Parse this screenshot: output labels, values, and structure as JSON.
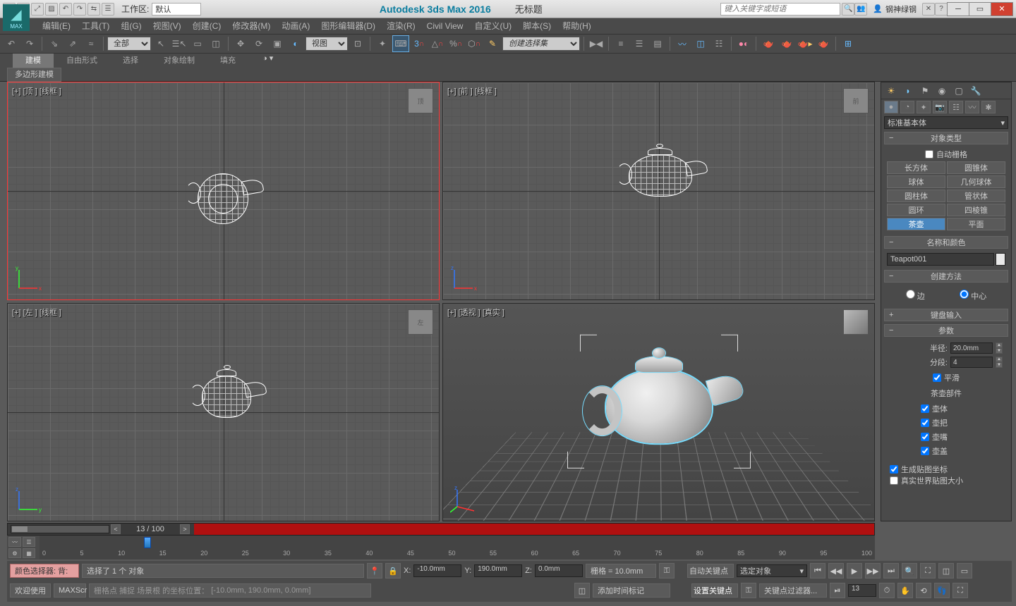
{
  "title": {
    "app": "Autodesk 3ds Max 2016",
    "doc": "无标题",
    "search_ph": "键入关键字或短语",
    "user": "钢神绿钢",
    "ws_label": "工作区:",
    "ws_value": "默认"
  },
  "menu": [
    "编辑(E)",
    "工具(T)",
    "组(G)",
    "视图(V)",
    "创建(C)",
    "修改器(M)",
    "动画(A)",
    "图形编辑器(D)",
    "渲染(R)",
    "Civil View",
    "自定义(U)",
    "脚本(S)",
    "帮助(H)"
  ],
  "toolbar": {
    "sel_filter": "全部",
    "view_mode": "视图",
    "named_sel": "创建选择集"
  },
  "ribbon": {
    "tabs": [
      "建模",
      "自由形式",
      "选择",
      "对象绘制",
      "填充"
    ],
    "subtab": "多边形建模"
  },
  "viewports": {
    "tl": "[+] [顶 ] [线框 ]",
    "tr": "[+] [前 ] [线框 ]",
    "bl": "[+] [左 ] [线框 ]",
    "br": "[+] [透视 ] [真实 ]",
    "cube_top": "顶",
    "cube_front": "前",
    "cube_left": "左"
  },
  "panel": {
    "dd": "标准基本体",
    "roll_objtype": "对象类型",
    "autogrid": "自动栅格",
    "objs": [
      "长方体",
      "圆锥体",
      "球体",
      "几何球体",
      "圆柱体",
      "管状体",
      "圆环",
      "四棱锥",
      "茶壶",
      "平面"
    ],
    "roll_name": "名称和颜色",
    "name_val": "Teapot001",
    "roll_method": "创建方法",
    "radio_edge": "边",
    "radio_center": "中心",
    "roll_kb": "键盘输入",
    "roll_params": "参数",
    "radius_l": "半径:",
    "radius_v": "20.0mm",
    "segs_l": "分段:",
    "segs_v": "4",
    "smooth": "平滑",
    "parts_head": "茶壶部件",
    "parts": [
      "壶体",
      "壶把",
      "壶嘴",
      "壶盖"
    ],
    "mapcoords": "生成贴图坐标",
    "realworld": "真实世界贴图大小"
  },
  "track": {
    "frame": "13 / 100"
  },
  "timeline": {
    "ticks": [
      "0",
      "5",
      "10",
      "15",
      "20",
      "25",
      "30",
      "35",
      "40",
      "45",
      "50",
      "55",
      "60",
      "65",
      "70",
      "75",
      "80",
      "85",
      "90",
      "95",
      "100"
    ]
  },
  "status": {
    "colorpicker": "颜色选择器:  背:",
    "welcome": "欢迎使用",
    "maxscr": "MAXScr",
    "sel": "选择了 1 个 对象",
    "prompt": "栅格点 捕捉 场景根 的坐标位置：",
    "coords_str": "[-10.0mm, 190.0mm, 0.0mm]",
    "x_l": "X:",
    "x_v": "-10.0mm",
    "y_l": "Y:",
    "y_v": "190.0mm",
    "z_l": "Z:",
    "z_v": "0.0mm",
    "grid": "栅格 = 10.0mm",
    "autokey": "自动关键点",
    "setkey": "设置关键点",
    "seldd": "选定对象",
    "keyfilter": "关键点过滤器...",
    "addtag": "添加时间标记",
    "spin_l": "13",
    "spin_r": "13"
  }
}
